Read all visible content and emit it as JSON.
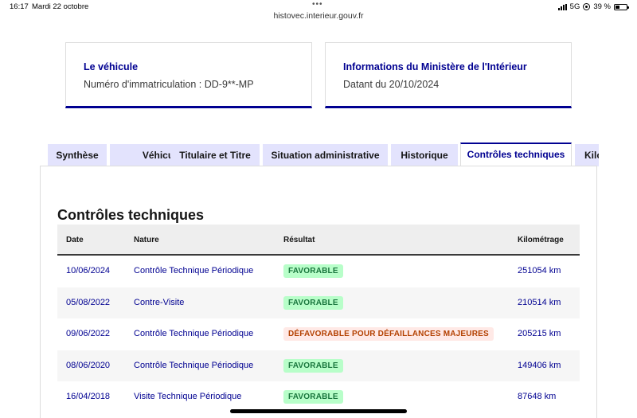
{
  "status_bar": {
    "time": "16:17",
    "date": "Mardi 22 octobre",
    "multitask_dots": "•••",
    "network": "5G",
    "battery_text": "39 %",
    "battery_level": 0.39
  },
  "browser": {
    "url": "histovec.interieur.gouv.fr"
  },
  "cards": {
    "vehicle": {
      "title": "Le véhicule",
      "text": "Numéro d'immatriculation : DD-9**-MP"
    },
    "ministry": {
      "title": "Informations du Ministère de l'Intérieur",
      "text": "Datant du 20/10/2024"
    }
  },
  "tabs": [
    {
      "label": "Synthèse"
    },
    {
      "label": "Véhicule"
    },
    {
      "label": "Titulaire et Titre"
    },
    {
      "label": "Situation administrative"
    },
    {
      "label": "Historique"
    },
    {
      "label": "Contrôles techniques",
      "active": true
    },
    {
      "label": "Kilométrage"
    }
  ],
  "section": {
    "title": "Contrôles techniques"
  },
  "table": {
    "headers": {
      "date": "Date",
      "nature": "Nature",
      "result": "Résultat",
      "km": "Kilométrage"
    },
    "rows": [
      {
        "date": "10/06/2024",
        "nature": "Contrôle Technique Périodique",
        "result": "FAVORABLE",
        "status": "ok",
        "km": "251054 km"
      },
      {
        "date": "05/08/2022",
        "nature": "Contre-Visite",
        "result": "FAVORABLE",
        "status": "ok",
        "km": "210514 km"
      },
      {
        "date": "09/06/2022",
        "nature": "Contrôle Technique Périodique",
        "result": "DÉFAVORABLE POUR DÉFAILLANCES MAJEURES",
        "status": "ko",
        "km": "205215 km"
      },
      {
        "date": "08/06/2020",
        "nature": "Contrôle Technique Périodique",
        "result": "FAVORABLE",
        "status": "ok",
        "km": "149406 km"
      },
      {
        "date": "16/04/2018",
        "nature": "Visite Technique Périodique",
        "result": "FAVORABLE",
        "status": "ok",
        "km": "87648 km"
      }
    ]
  },
  "colors": {
    "accent": "#000091",
    "favorable_bg": "#b8fec9",
    "favorable_text": "#18753c",
    "defavorable_bg": "#ffe9e6",
    "defavorable_text": "#b34000"
  }
}
